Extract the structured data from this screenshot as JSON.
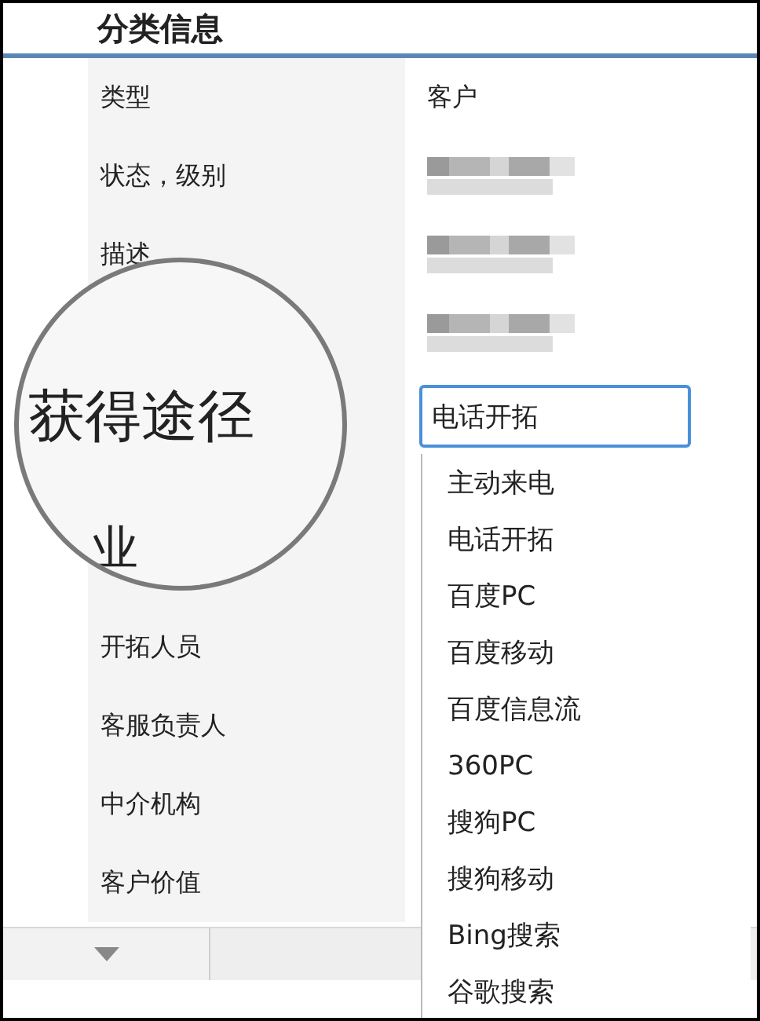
{
  "section": {
    "title": "分类信息"
  },
  "rows": [
    {
      "label": "类型",
      "value": "客户"
    },
    {
      "label": "状态，级别",
      "blurred": true
    },
    {
      "label": "描述",
      "blurred": true
    },
    {
      "blurred": true
    },
    {},
    {},
    {},
    {
      "label": "开拓人员"
    },
    {
      "label": "客服负责人"
    },
    {
      "label": "中介机构"
    },
    {
      "label": "客户价值"
    }
  ],
  "magnifier": {
    "labels": [
      "获得途径",
      "业"
    ]
  },
  "source_field": {
    "value": "电话开拓"
  },
  "source_options": [
    "主动来电",
    "电话开拓",
    "百度PC",
    "百度移动",
    "百度信息流",
    "360PC",
    "搜狗PC",
    "搜狗移动",
    "Bing搜索",
    "谷歌搜索"
  ]
}
